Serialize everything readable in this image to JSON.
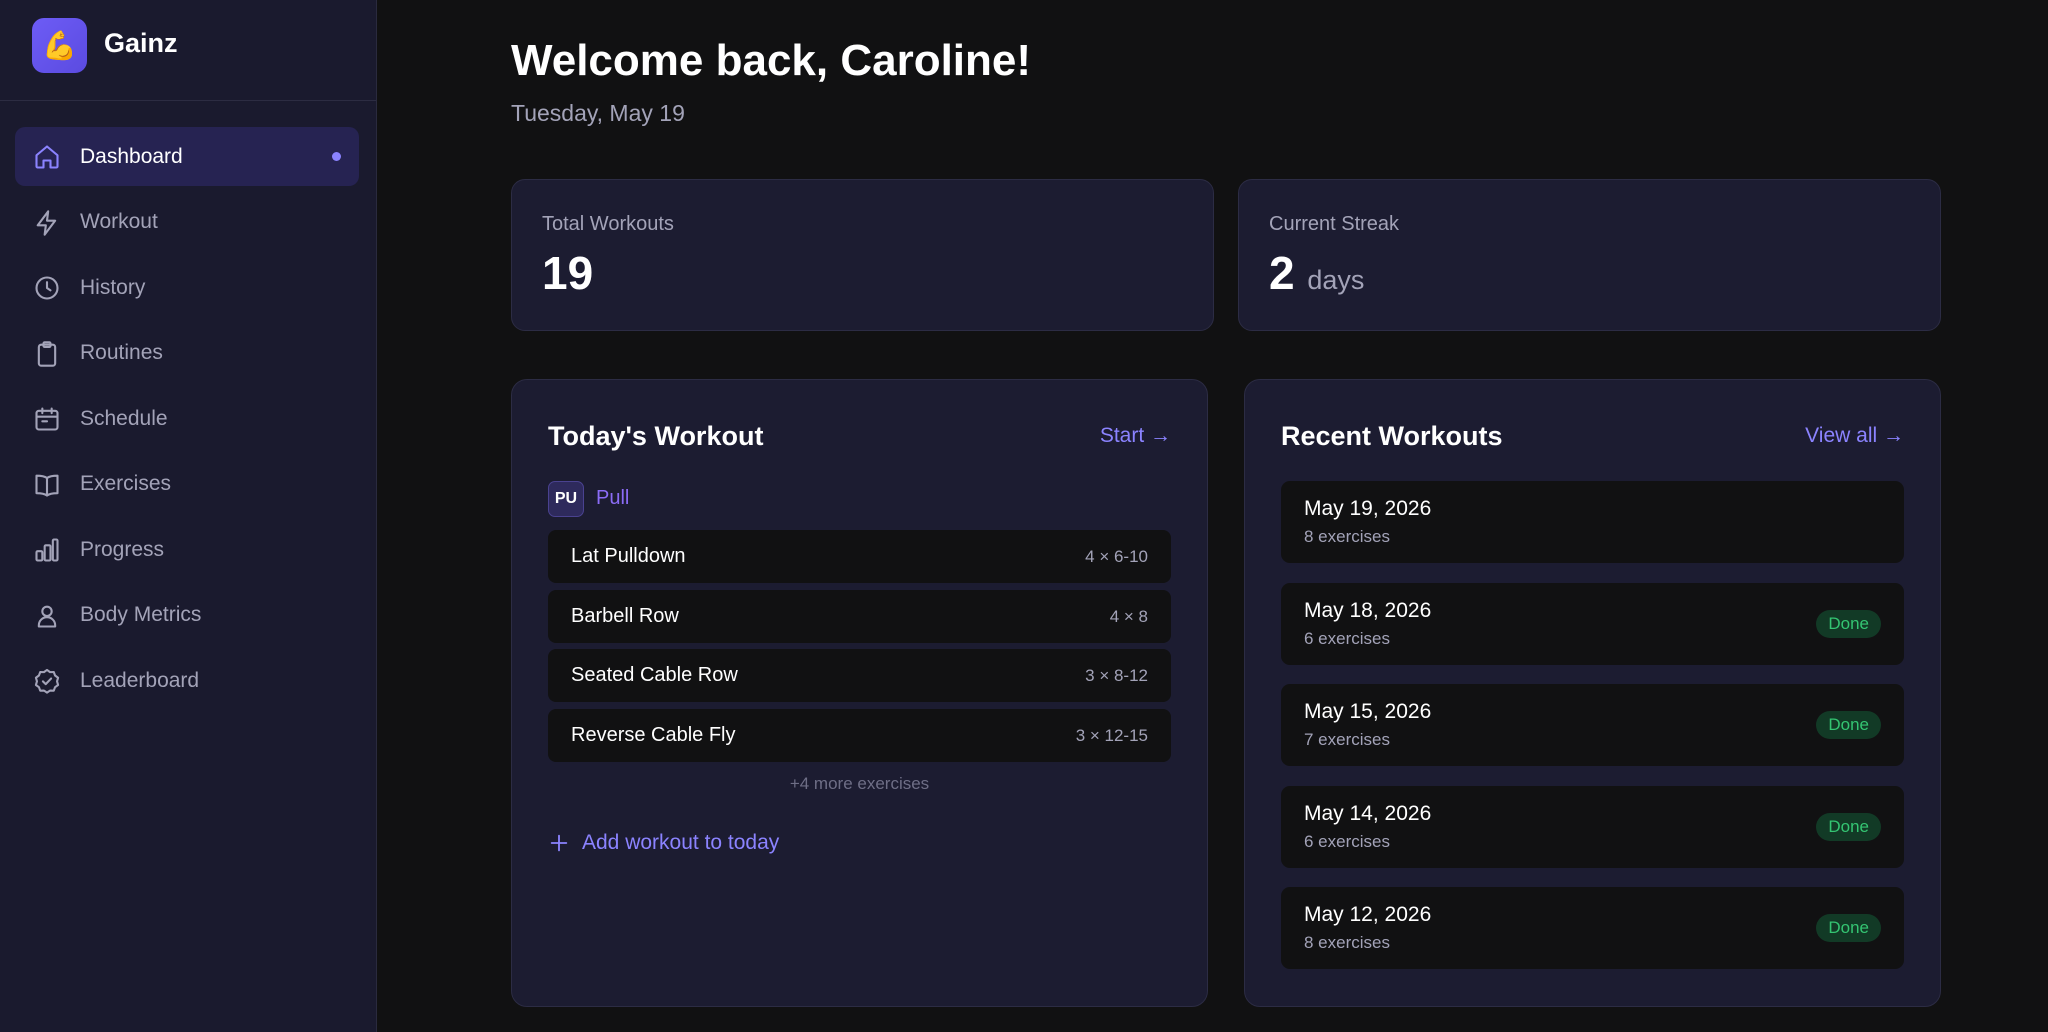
{
  "app": {
    "name": "Gainz",
    "logo_emoji": "💪",
    "accent": "#8b83ff"
  },
  "sidebar": {
    "items": [
      {
        "label": "Dashboard",
        "icon": "home-icon",
        "active": true
      },
      {
        "label": "Workout",
        "icon": "lightning-icon"
      },
      {
        "label": "History",
        "icon": "clock-icon"
      },
      {
        "label": "Routines",
        "icon": "clipboard-icon"
      },
      {
        "label": "Schedule",
        "icon": "calendar-icon"
      },
      {
        "label": "Exercises",
        "icon": "book-icon"
      },
      {
        "label": "Progress",
        "icon": "bar-chart-icon"
      },
      {
        "label": "Body Metrics",
        "icon": "person-icon"
      },
      {
        "label": "Leaderboard",
        "icon": "badge-check-icon"
      }
    ]
  },
  "header": {
    "title": "Welcome back, Caroline!",
    "date": "Tuesday, May 19"
  },
  "stats": {
    "total_workouts": {
      "label": "Total Workouts",
      "value": "19"
    },
    "current_streak": {
      "label": "Current Streak",
      "value": "2",
      "unit": "days"
    }
  },
  "today": {
    "title": "Today's Workout",
    "start_label": "Start →",
    "routine": {
      "badge": "PU",
      "name": "Pull"
    },
    "exercises": [
      {
        "name": "Lat Pulldown",
        "sets": "4 × 6-10"
      },
      {
        "name": "Barbell Row",
        "sets": "4 × 8"
      },
      {
        "name": "Seated Cable Row",
        "sets": "3 × 8-12"
      },
      {
        "name": "Reverse Cable Fly",
        "sets": "3 × 12-15"
      }
    ],
    "more": "+4 more exercises",
    "add_label": "Add workout to today"
  },
  "recent": {
    "title": "Recent Workouts",
    "view_all_label": "View all →",
    "items": [
      {
        "date": "May 19, 2026",
        "count": "8 exercises",
        "badge": ""
      },
      {
        "date": "May 18, 2026",
        "count": "6 exercises",
        "badge": "Done"
      },
      {
        "date": "May 15, 2026",
        "count": "7 exercises",
        "badge": "Done"
      },
      {
        "date": "May 14, 2026",
        "count": "6 exercises",
        "badge": "Done"
      },
      {
        "date": "May 12, 2026",
        "count": "8 exercises",
        "badge": "Done"
      }
    ],
    "done_color": "#34c472"
  }
}
